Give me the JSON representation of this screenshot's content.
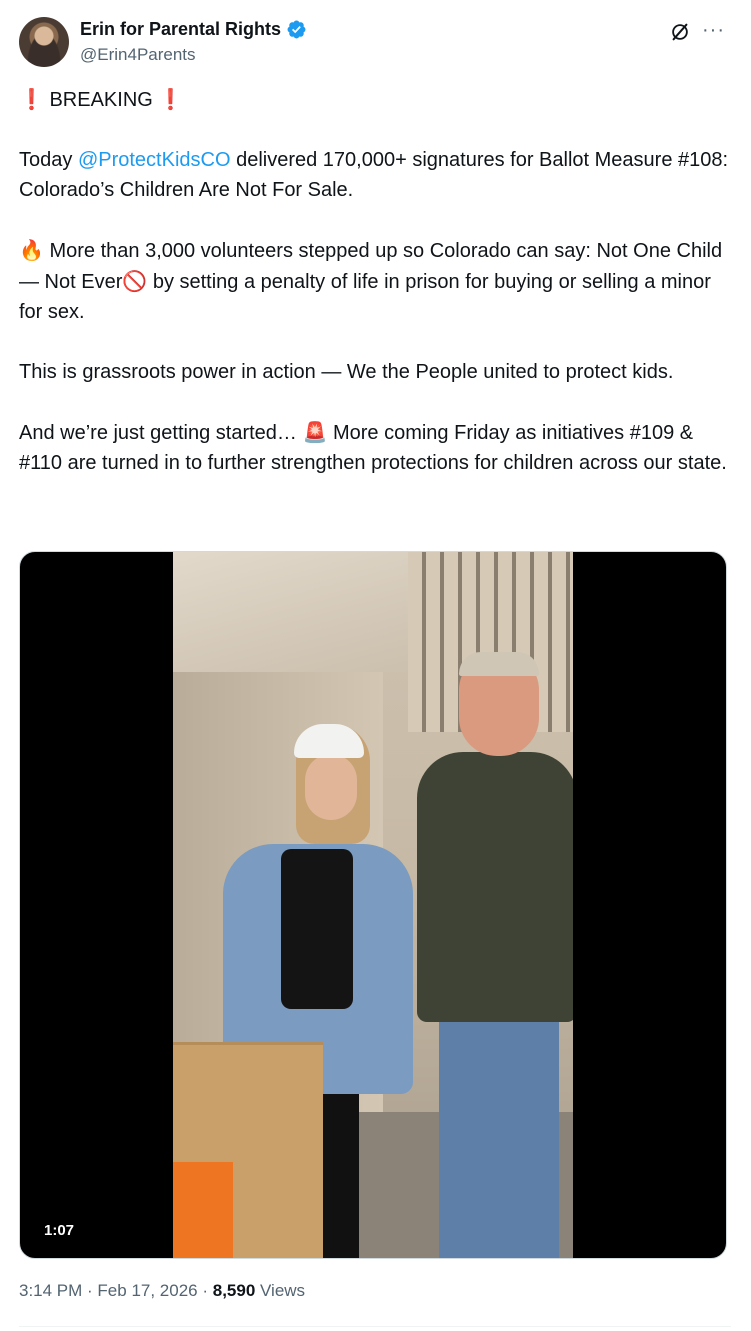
{
  "author": {
    "display_name": "Erin for Parental Rights",
    "handle": "@Erin4Parents",
    "verified": true,
    "verified_color": "#1d9bf0"
  },
  "actions": {
    "grok_icon": "grok-icon",
    "more_icon": "more-icon",
    "more_glyph": "···"
  },
  "tweet": {
    "p1_emoji_left": "❗",
    "p1_text": " BREAKING ",
    "p1_emoji_right": "❗",
    "p2_before": "Today ",
    "p2_mention": "@ProtectKidsCO",
    "p2_after": " delivered 170,000+ signatures for Ballot Measure #108: Colorado’s Children Are Not For Sale.",
    "p3_emoji": "🔥",
    "p3_text_a": " More than 3,000 volunteers stepped up so Colorado can say: Not One Child — Not Ever",
    "p3_emoji_b": "🚫",
    "p3_text_b": " by setting a penalty of life in prison for buying or selling a minor for sex.",
    "p4_text": "This is grassroots power in action — We the People united to protect kids.",
    "p5_text_a": "And we’re just getting started… ",
    "p5_emoji": "🚨",
    "p5_text_b": " More coming Friday as initiatives #109 & #110 are turned in to further strengthen protections for children across our state.",
    "mention_color": "#1d9bf0"
  },
  "media": {
    "duration": "1:07"
  },
  "meta": {
    "time": "3:14 PM",
    "separator1": " · ",
    "date": "Feb 17, 2026",
    "separator2": " · ",
    "views_count": "8,590",
    "views_label": " Views"
  }
}
